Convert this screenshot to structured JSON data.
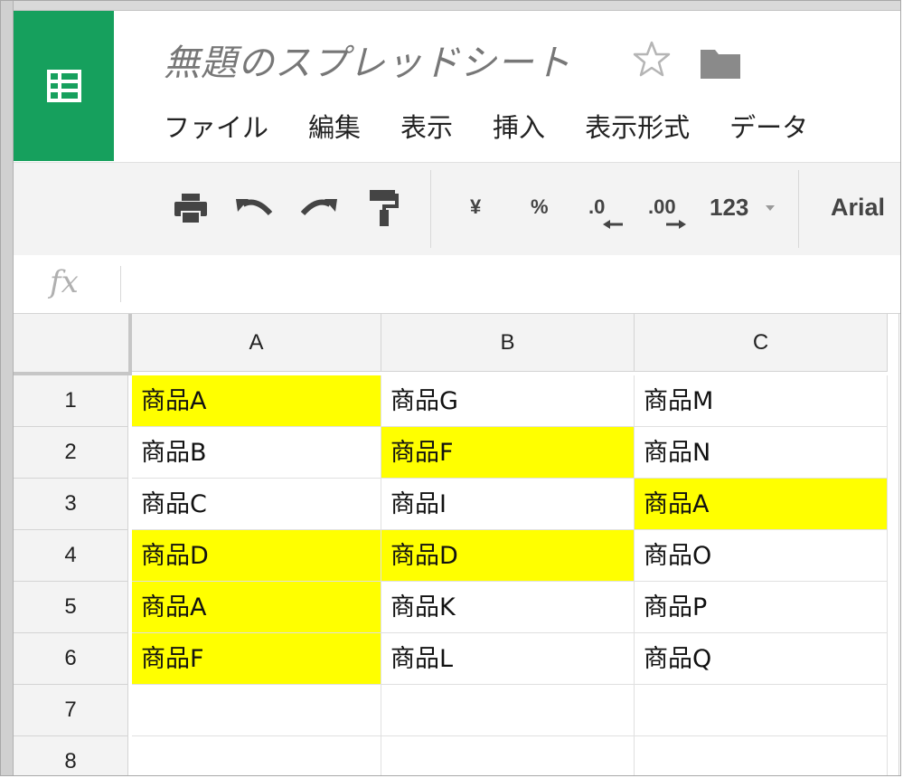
{
  "app": {
    "title": "無題のスプレッドシート",
    "brand_color": "#16a05d"
  },
  "menu": {
    "items": [
      "ファイル",
      "編集",
      "表示",
      "挿入",
      "表示形式",
      "データ"
    ]
  },
  "toolbar": {
    "currency_label": "¥",
    "percent_label": "%",
    "decrease_decimal_label": ".0",
    "increase_decimal_label": ".00",
    "number_format_label": "123",
    "font_label": "Arial"
  },
  "formula_bar": {
    "fx_label": "fx",
    "value": ""
  },
  "sheet": {
    "columns": [
      "A",
      "B",
      "C"
    ],
    "rows": [
      "1",
      "2",
      "3",
      "4",
      "5",
      "6",
      "7",
      "8"
    ],
    "highlight_color": "#ffff00",
    "cells": [
      [
        {
          "v": "商品A",
          "hl": true
        },
        {
          "v": "商品G",
          "hl": false
        },
        {
          "v": "商品M",
          "hl": false
        }
      ],
      [
        {
          "v": "商品B",
          "hl": false
        },
        {
          "v": "商品F",
          "hl": true
        },
        {
          "v": "商品N",
          "hl": false
        }
      ],
      [
        {
          "v": "商品C",
          "hl": false
        },
        {
          "v": "商品I",
          "hl": false
        },
        {
          "v": "商品A",
          "hl": true
        }
      ],
      [
        {
          "v": "商品D",
          "hl": true
        },
        {
          "v": "商品D",
          "hl": true
        },
        {
          "v": "商品O",
          "hl": false
        }
      ],
      [
        {
          "v": "商品A",
          "hl": true
        },
        {
          "v": "商品K",
          "hl": false
        },
        {
          "v": "商品P",
          "hl": false
        }
      ],
      [
        {
          "v": "商品F",
          "hl": true
        },
        {
          "v": "商品L",
          "hl": false
        },
        {
          "v": "商品Q",
          "hl": false
        }
      ],
      [
        {
          "v": "",
          "hl": false
        },
        {
          "v": "",
          "hl": false
        },
        {
          "v": "",
          "hl": false
        }
      ],
      [
        {
          "v": "",
          "hl": false
        },
        {
          "v": "",
          "hl": false
        },
        {
          "v": "",
          "hl": false
        }
      ]
    ]
  }
}
